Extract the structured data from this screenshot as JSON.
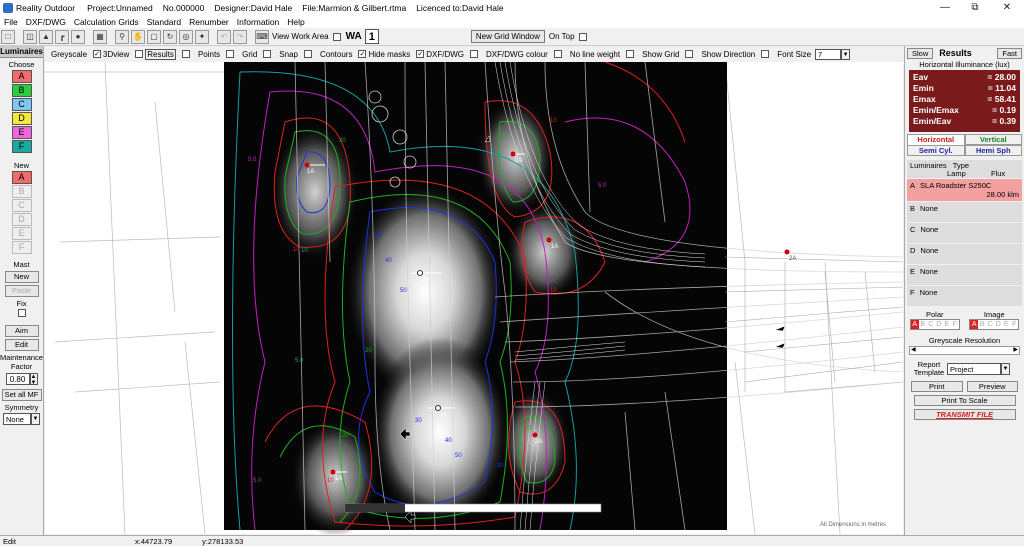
{
  "title": {
    "app": "Reality Outdoor",
    "project": "Project:Unnamed",
    "number": "No.000000",
    "designer": "Designer:David Hale",
    "file": "File:Marmion & Gilbert.rtma",
    "licence": "Licenced to:David Hale"
  },
  "menu": [
    "File",
    "DXF/DWG",
    "Calculation Grids",
    "Standard",
    "Renumber",
    "Information",
    "Help"
  ],
  "toolbar": {
    "view_work_area": "View Work Area",
    "wa": "WA",
    "wa_num": "1",
    "new_grid": "New Grid Window",
    "on_top": "On Top"
  },
  "options": {
    "greyscale": "Greyscale",
    "view3d": "3Dview",
    "results": "Results",
    "points": "Points",
    "grid": "Grid",
    "snap": "Snap",
    "contours": "Contours",
    "hide_masks": "Hide masks",
    "dxf": "DXF/DWG",
    "dxf_colour": "DXF/DWG colour",
    "no_line_weight": "No line weight",
    "show_grid": "Show Grid",
    "show_direction": "Show Direction",
    "font_size": "Font Size",
    "font_size_value": "7"
  },
  "left": {
    "title": "Luminaires",
    "choose": "Choose",
    "choose_items": [
      {
        "label": "A",
        "color": "#f26b6b"
      },
      {
        "label": "B",
        "color": "#2ecc40"
      },
      {
        "label": "C",
        "color": "#7ec8f0"
      },
      {
        "label": "D",
        "color": "#f5e83a"
      },
      {
        "label": "E",
        "color": "#ee66dd"
      },
      {
        "label": "F",
        "color": "#1aa8a0"
      }
    ],
    "new": "New",
    "new_items": [
      "A",
      "B",
      "C",
      "D",
      "E",
      "F"
    ],
    "mast": "Mast",
    "mast_new": "New",
    "paste": "Paste",
    "fix": "Fix",
    "aim": "Aim",
    "edit": "Edit",
    "maint": "Maintenance Factor",
    "maint_value": "0.80",
    "set_all": "Set all MF",
    "symmetry": "Symmetry",
    "symmetry_value": "None"
  },
  "right": {
    "slow": "Slow",
    "results": "Results",
    "fast": "Fast",
    "subtitle": "Horizontal Illuminance (lux)",
    "stats": [
      {
        "k": "Eav",
        "v": "= 28.00"
      },
      {
        "k": "Emin",
        "v": "= 11.04"
      },
      {
        "k": "Emax",
        "v": "= 58.41"
      },
      {
        "k": "Emin/Emax",
        "v": "= 0.19"
      },
      {
        "k": "Emin/Eav",
        "v": "= 0.39"
      }
    ],
    "tab_horizontal": "Horizontal",
    "tab_vertical": "Vertical",
    "tab_semicyl": "Semi Cyl.",
    "tab_hemisph": "Hemi Sph",
    "lum_header": "Luminaires",
    "type_header": "Type",
    "lamp_header": "Lamp",
    "flux_header": "Flux",
    "lums": [
      {
        "id": "A",
        "name": "SLA Roadster S250C",
        "flux": "28.00 klm"
      },
      {
        "id": "B",
        "name": "None",
        "flux": ""
      },
      {
        "id": "C",
        "name": "None",
        "flux": ""
      },
      {
        "id": "D",
        "name": "None",
        "flux": ""
      },
      {
        "id": "E",
        "name": "None",
        "flux": ""
      },
      {
        "id": "F",
        "name": "None",
        "flux": ""
      }
    ],
    "polar": "Polar",
    "image": "Image",
    "letters": [
      "A",
      "B",
      "C",
      "D",
      "E",
      "F"
    ],
    "greyscale_res": "Greyscale Resolution",
    "report": "Report Template",
    "report_value": "Project",
    "print": "Print",
    "preview": "Preview",
    "print_scale": "Print To Scale",
    "transmit": "TRANSMIT FILE"
  },
  "canvas": {
    "note": "All Dimensions in metres",
    "lum_labels": [
      "1A",
      "2A",
      "1A",
      "2A",
      "2A",
      "2A",
      "1A",
      "2A"
    ],
    "contour_labels": [
      "5.0",
      "10",
      "20",
      "30",
      "40",
      "50",
      "20",
      "10",
      "5.0",
      "30",
      "40",
      "50",
      "20",
      "10",
      "5.0",
      "10",
      "20",
      "30",
      "5.0",
      "10",
      "20"
    ]
  },
  "status": {
    "mode": "Edit",
    "x": "x:44723.79",
    "y": "y:278133.53"
  },
  "colors": {
    "results_bg": "#7a1a1a",
    "active_lum": "#f3a0a0",
    "contour_red": "#e02020",
    "contour_green": "#20b020",
    "contour_blue": "#2030e0",
    "contour_magenta": "#c020c0",
    "contour_cyan": "#10a0a0"
  }
}
